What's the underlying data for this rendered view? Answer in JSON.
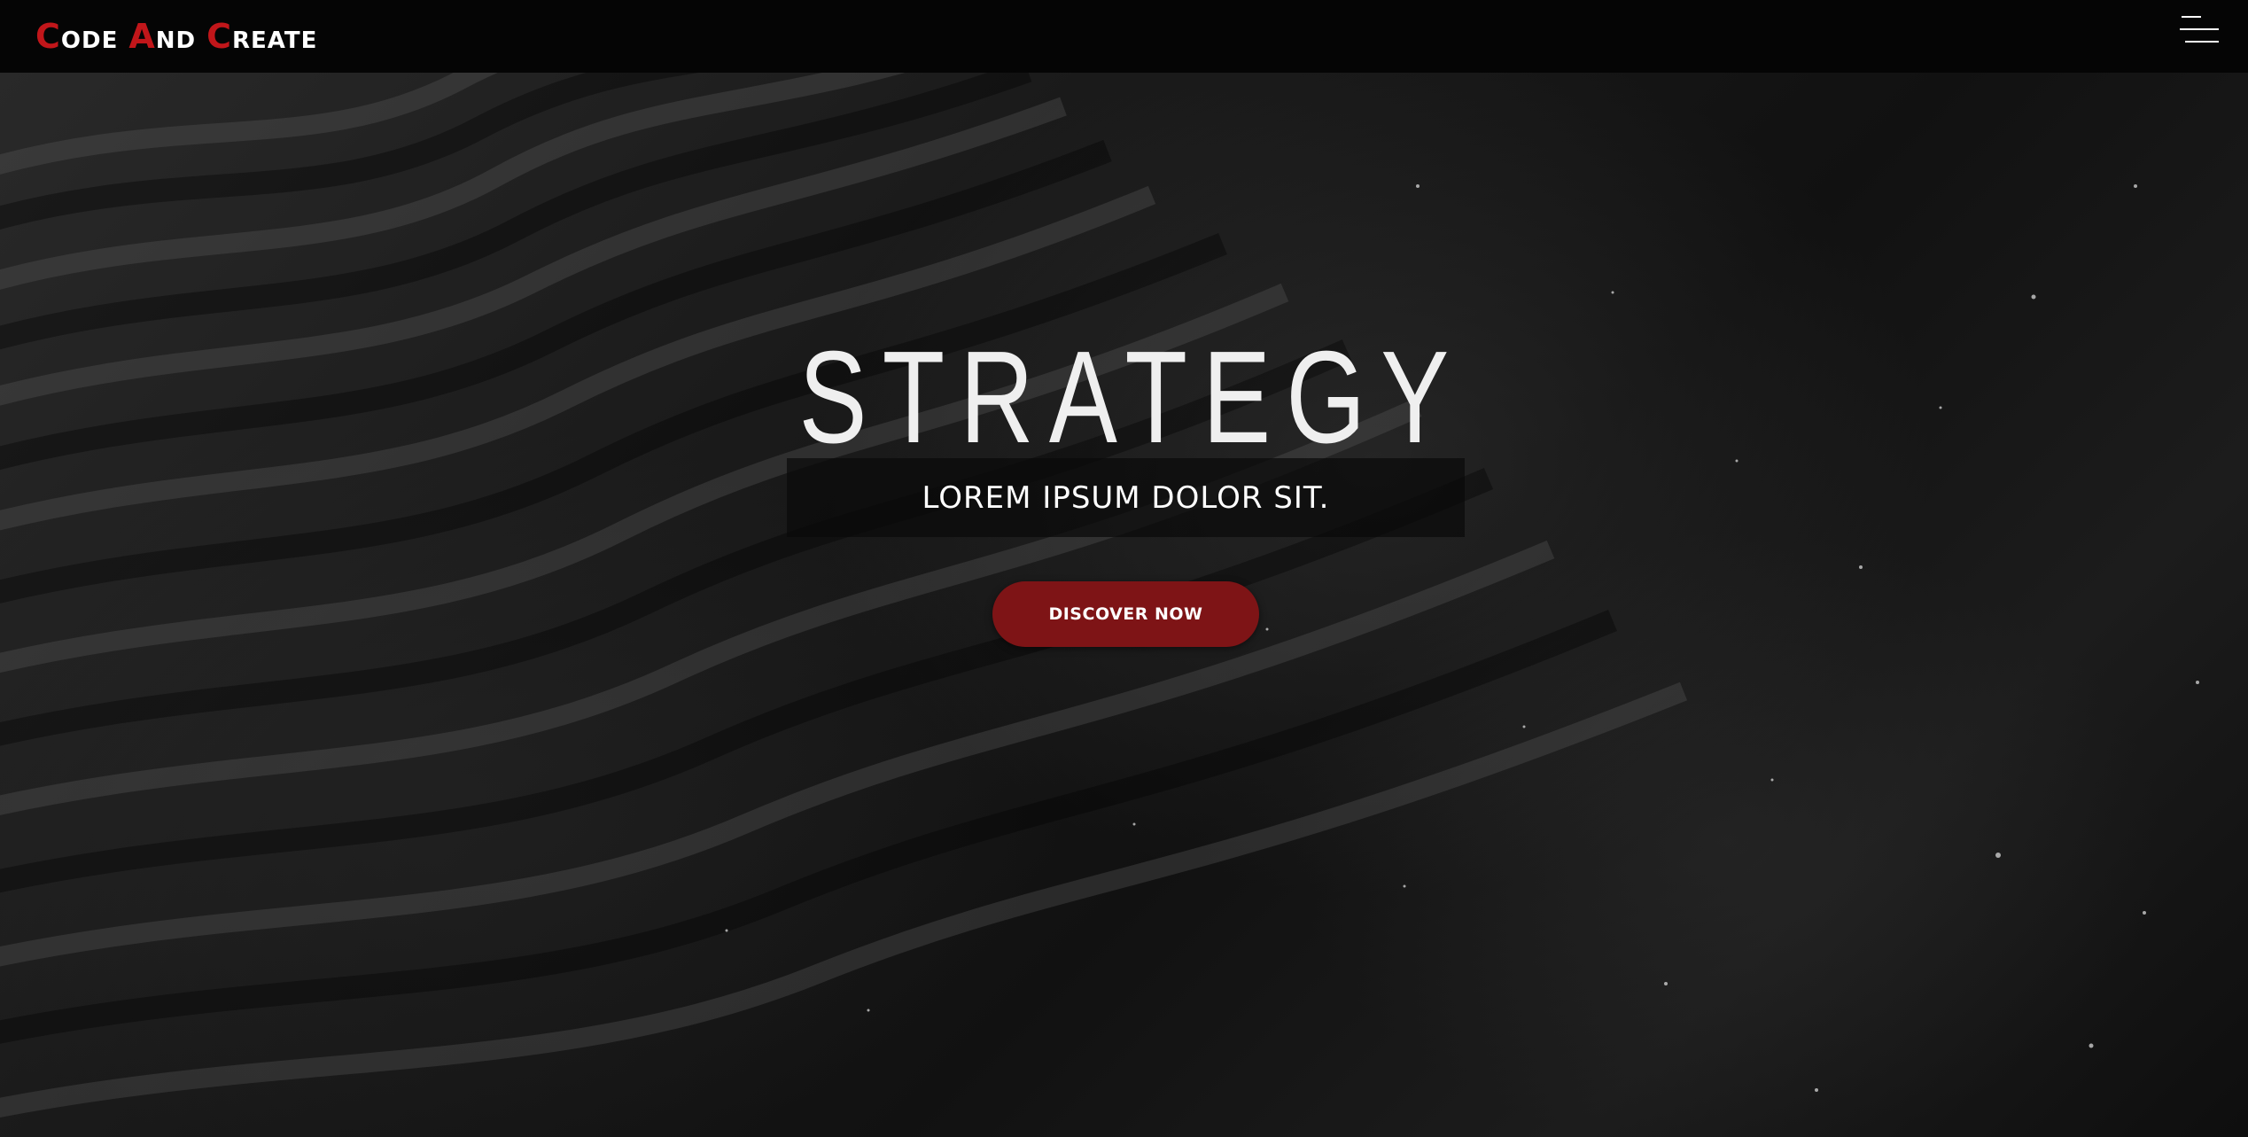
{
  "nav": {
    "logo": [
      {
        "cap": "C",
        "rest": "ode"
      },
      {
        "cap": "A",
        "rest": "nd"
      },
      {
        "cap": "C",
        "rest": "reate"
      }
    ],
    "menu_icon": "hamburger-icon"
  },
  "hero": {
    "title": "STRATEGY",
    "subtitle": "LOREM IPSUM DOLOR SIT.",
    "cta_label": "DISCOVER NOW"
  },
  "colors": {
    "accent": "#c1161a",
    "button": "#7e1416",
    "nav_bg": "#050505",
    "text": "#ffffff"
  }
}
